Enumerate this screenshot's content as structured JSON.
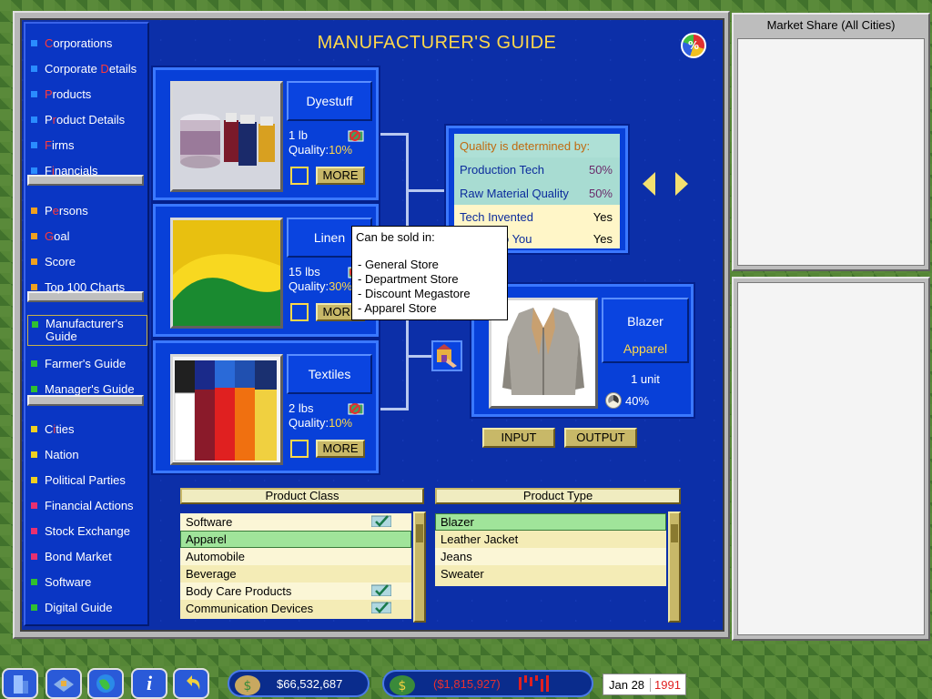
{
  "title": "MANUFACTURER'S GUIDE",
  "market_share_icon": "%",
  "sidebar": {
    "items": [
      {
        "first": "C",
        "rest": "orporations",
        "color": "#2a8cff"
      },
      {
        "first": "Corporate ",
        "rest": "",
        "html": "Corporate Details",
        "color": "#2a8cff"
      },
      {
        "first": "P",
        "rest": "roducts",
        "color": "#2a8cff"
      },
      {
        "first": "Pr",
        "rest": "oduct Details",
        "color": "#2a8cff"
      },
      {
        "first": "F",
        "rest": "irms",
        "color": "#2a8cff"
      },
      {
        "first": "Fi",
        "rest": "nancials",
        "color": "#2a8cff"
      },
      {
        "first": "Pe",
        "rest": "rsons",
        "color": "#f0a020"
      },
      {
        "first": "G",
        "rest": "oal",
        "color": "#f0a020"
      },
      {
        "first": "S",
        "rest": "core",
        "color": "#f0a020"
      },
      {
        "first": "T",
        "rest": "op 100 Charts",
        "color": "#f0a020"
      },
      {
        "first": "M",
        "rest": "anufacturer's Guide",
        "color": "#30c030"
      },
      {
        "first": "F",
        "rest": "armer's Guide",
        "color": "#30c030"
      },
      {
        "first": "M",
        "rest": "anager's Guide",
        "color": "#30c030"
      },
      {
        "first": "Ci",
        "rest": "ties",
        "color": "#f0d020"
      },
      {
        "first": "N",
        "rest": "ation",
        "color": "#f0d020"
      },
      {
        "first": "P",
        "rest": "olitical Parties",
        "color": "#f0d020"
      },
      {
        "first": "F",
        "rest": "inancial Actions",
        "color": "#e83070"
      },
      {
        "first": "S",
        "rest": "tock Exchange",
        "color": "#e83070"
      },
      {
        "first": "B",
        "rest": "ond Market",
        "color": "#e83070"
      },
      {
        "first": "S",
        "rest": "oftware",
        "color": "#30c030"
      },
      {
        "first": "D",
        "rest": "igital Guide",
        "color": "#30c030"
      }
    ],
    "labels": [
      "Corporations",
      "Corporate Details",
      "Products",
      "Product Details",
      "Firms",
      "Financials",
      "Persons",
      "Goal",
      "Score",
      "Top 100 Charts",
      "Manufacturer's Guide",
      "Farmer's Guide",
      "Manager's Guide",
      "Cities",
      "Nation",
      "Political Parties",
      "Financial Actions",
      "Stock Exchange",
      "Bond Market",
      "Software",
      "Digital Guide"
    ]
  },
  "inputs": [
    {
      "name": "Dyestuff",
      "qty": "1 lb",
      "quality_label": "Quality:",
      "quality": "10%",
      "more": "MORE"
    },
    {
      "name": "Linen",
      "qty": "15 lbs",
      "quality_label": "Quality:",
      "quality": "30%",
      "more": "MORE"
    },
    {
      "name": "Textiles",
      "qty": "2 lbs",
      "quality_label": "Quality:",
      "quality": "10%",
      "more": "MORE"
    }
  ],
  "quality_panel": {
    "header": "Quality is determined by:",
    "rows": [
      {
        "label": "Production Tech",
        "value": "50%"
      },
      {
        "label": "Raw Material Quality",
        "value": "50%"
      },
      {
        "label": "Tech Invented",
        "value": "Yes"
      },
      {
        "label": "Known to You",
        "value": "Yes"
      }
    ]
  },
  "output": {
    "name": "Blazer",
    "class": "Apparel",
    "qty": "1 unit",
    "quality": "40%"
  },
  "io_buttons": {
    "input": "INPUT",
    "output": "OUTPUT"
  },
  "tooltip": {
    "heading": "Can be sold in:",
    "items": [
      "- General Store",
      "- Department Store",
      "- Discount Megastore",
      "- Apparel Store"
    ]
  },
  "product_class": {
    "header": "Product Class",
    "items": [
      {
        "label": "Software",
        "check": true
      },
      {
        "label": "Apparel",
        "check": false,
        "selected": true
      },
      {
        "label": "Automobile",
        "check": false
      },
      {
        "label": "Beverage",
        "check": false
      },
      {
        "label": "Body Care Products",
        "check": true
      },
      {
        "label": "Communication Devices",
        "check": true
      }
    ]
  },
  "product_type": {
    "header": "Product Type",
    "items": [
      {
        "label": "Blazer",
        "selected": true
      },
      {
        "label": "Leather Jacket"
      },
      {
        "label": "Jeans"
      },
      {
        "label": "Sweater"
      }
    ]
  },
  "right_panels": {
    "top_title": "Market Share (All Cities)"
  },
  "status": {
    "cash": "$66,532,687",
    "profit": "($1,815,927)",
    "month_day": "Jan 28",
    "year": "1991"
  },
  "colors": {
    "accent": "#ffd84a",
    "panel_blue": "#0840d8",
    "loss_red": "#e83030"
  }
}
